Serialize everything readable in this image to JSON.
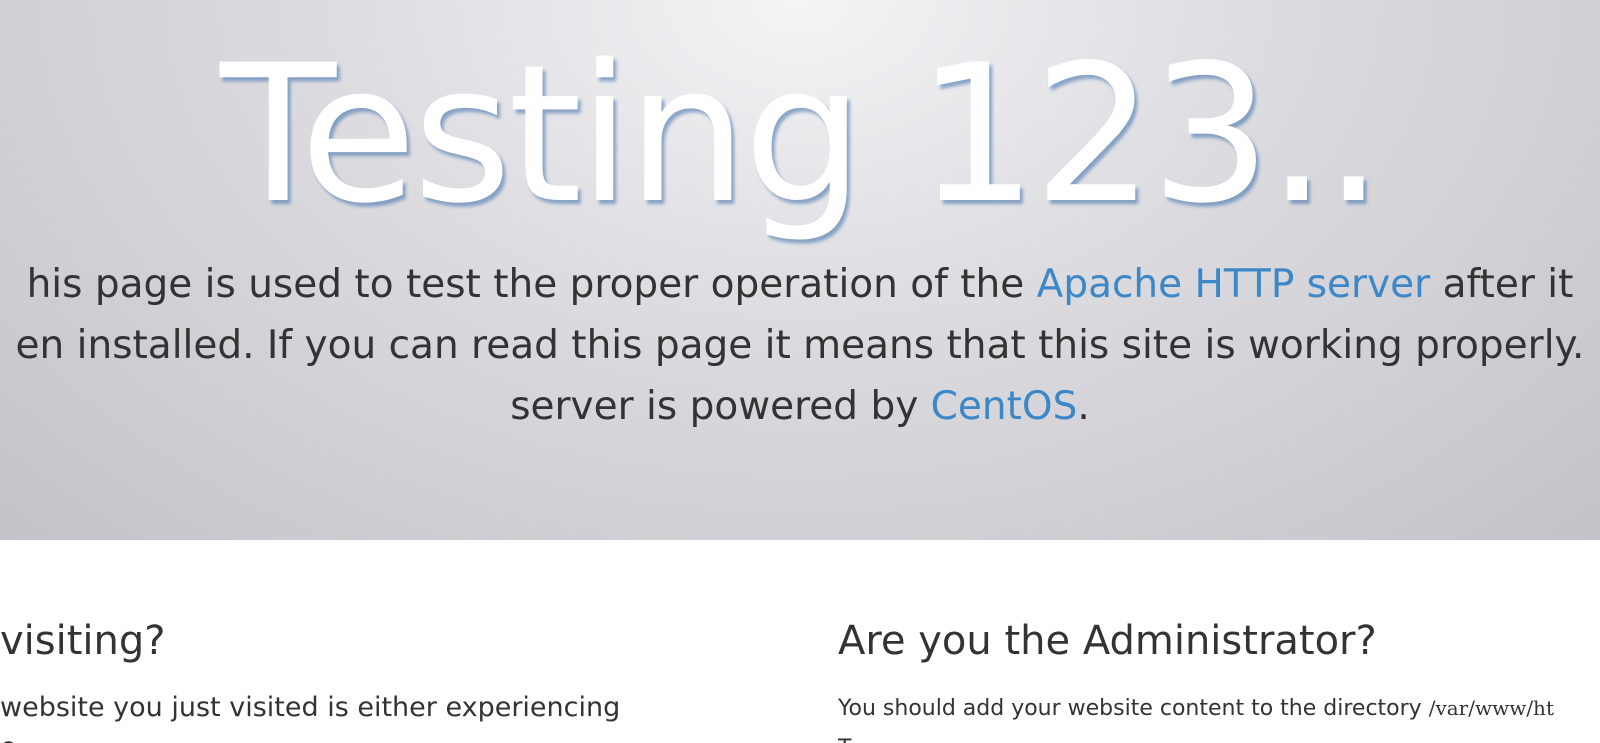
{
  "hero": {
    "title": "Testing 123..",
    "line1_before": "his page is used to test the proper operation of the ",
    "line1_link": "Apache HTTP server",
    "line1_after": " after it",
    "line2": "en installed. If you can read this page it means that this site is working properly.",
    "line3_before": "server is powered by ",
    "line3_link": "CentOS",
    "line3_after": "."
  },
  "visitor_section": {
    "heading": "visiting?",
    "line1": "website you just visited is either experiencing",
    "line2": "e"
  },
  "admin_section": {
    "heading": "Are you the Administrator?",
    "line1": "You should add your website content to the directory ",
    "path": "/var/www/ht",
    "line2": "T"
  },
  "colors": {
    "link": "#3c87c7",
    "text": "#333333",
    "title": "#ffffff"
  }
}
